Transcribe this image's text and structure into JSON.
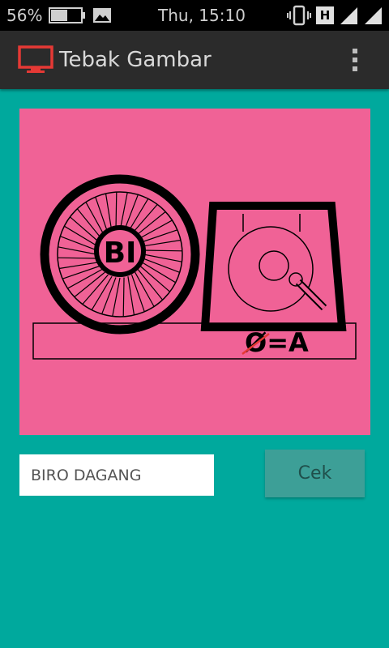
{
  "status_bar": {
    "battery_percent": "56%",
    "battery_level": 0.56,
    "clock": "Thu, 15:10",
    "network_badge": "H",
    "icons": [
      "battery-icon",
      "image-icon",
      "vibrate-icon",
      "network-type-icon",
      "signal-icon",
      "signal-icon"
    ]
  },
  "app_bar": {
    "title": "Tebak Gambar",
    "icon": "tv-icon",
    "menu_icon": "overflow-menu-icon",
    "icon_color": "#e53935"
  },
  "puzzle": {
    "wheel_text": "BI",
    "hint_text": "Ø=A",
    "background": "#f06296"
  },
  "answer": {
    "value": "BIRO DAGANG"
  },
  "check_button": {
    "label": "Cek"
  },
  "colors": {
    "background": "#00a99d",
    "app_bar": "#2b2b2b",
    "status_bar": "#000000",
    "button": "#3d9f97"
  }
}
